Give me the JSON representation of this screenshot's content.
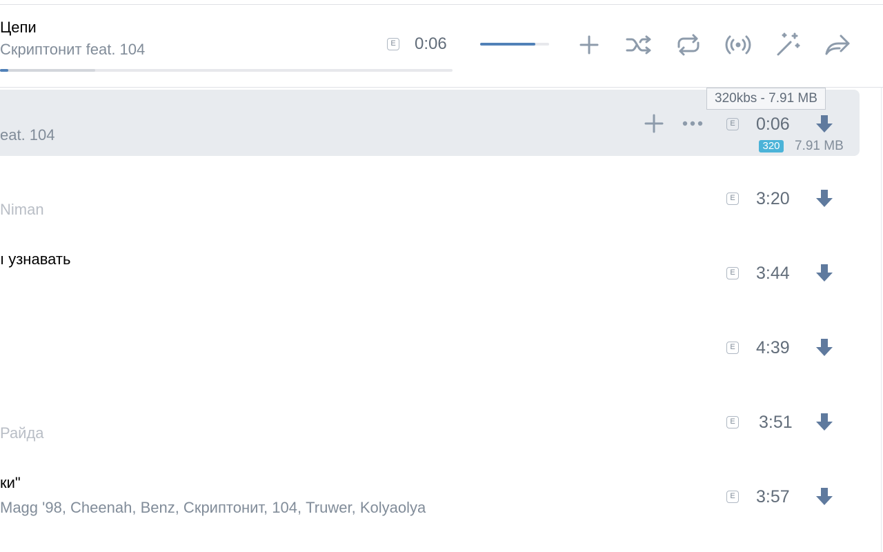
{
  "player": {
    "title": "Цепи",
    "artist": "Скриптонит feat. 104",
    "explicit_badge": "E",
    "time": "0:06",
    "progress_fraction": 0.018,
    "buffered_fraction": 0.21,
    "volume_fraction": 0.8,
    "icons": [
      "plus-icon",
      "shuffle-icon",
      "repeat-icon",
      "broadcast-icon",
      "magic-wand-icon",
      "share-icon"
    ]
  },
  "tooltip": "320kbs - 7.91 MB",
  "tracks": [
    {
      "title": "",
      "artist": "eat. 104",
      "duration": "0:06",
      "quality": "320",
      "size": "7.91 MB"
    },
    {
      "title": "",
      "artist": "Niman",
      "duration": "3:20"
    },
    {
      "title": "ı узнавать",
      "artist": "",
      "duration": "3:44"
    },
    {
      "title": "",
      "artist": "",
      "duration": "4:39"
    },
    {
      "title": "",
      "artist": "Райда",
      "duration": "3:51"
    },
    {
      "title": "ки\"",
      "artist": "Magg '98, Cheenah, Benz, Скриптонит, 104, Truwer, Kolyaolya",
      "duration": "3:57"
    }
  ],
  "explicit_badge": "E",
  "colors": {
    "accent": "#5181b8",
    "active_row": "#e8ebef",
    "icon": "#8d9bab",
    "quality_badge": "#4bb3d8"
  }
}
